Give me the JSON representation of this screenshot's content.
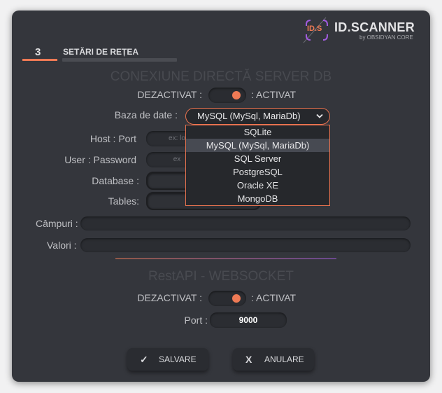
{
  "brand": {
    "logo_mark": "ID.S",
    "name": "ID.SCANNER",
    "tagline": "by OBSIDYAN CORE",
    "accent_color": "#ee7a55",
    "purple_color": "#a25ce0"
  },
  "step": {
    "number": "3",
    "title": "SETĂRI DE REȚEA"
  },
  "db_section": {
    "title": "CONEXIUNE DIRECTĂ SERVER DB",
    "toggle_off_label": "DEZACTIVAT :",
    "toggle_on_label": ": ACTIVAT",
    "toggle_state": "on",
    "database_type_label": "Baza de date :",
    "database_type_value": "MySQL (MySql, MariaDb)",
    "options": [
      "SQLite",
      "MySQL (MySql, MariaDb)",
      "SQL Server",
      "PostgreSQL",
      "Oracle XE",
      "MongoDB"
    ],
    "selected_option": "MySQL (MySql, MariaDb)",
    "host_port_label": "Host : Port",
    "host_placeholder": "ex: lo",
    "user_password_label": "User : Password",
    "user_placeholder": "ex",
    "database_label": "Database :",
    "tables_label": "Tables:"
  },
  "fields_label": "Câmpuri :",
  "values_label": "Valori :",
  "rest_section": {
    "title": "RestAPI - WEBSOCKET",
    "toggle_off_label": "DEZACTIVAT :",
    "toggle_on_label": ": ACTIVAT",
    "toggle_state": "on",
    "port_label": "Port :",
    "port_value": "9000"
  },
  "buttons": {
    "save_label": "SALVARE",
    "save_icon": "check-icon",
    "cancel_label": "ANULARE",
    "cancel_icon": "x-icon"
  }
}
